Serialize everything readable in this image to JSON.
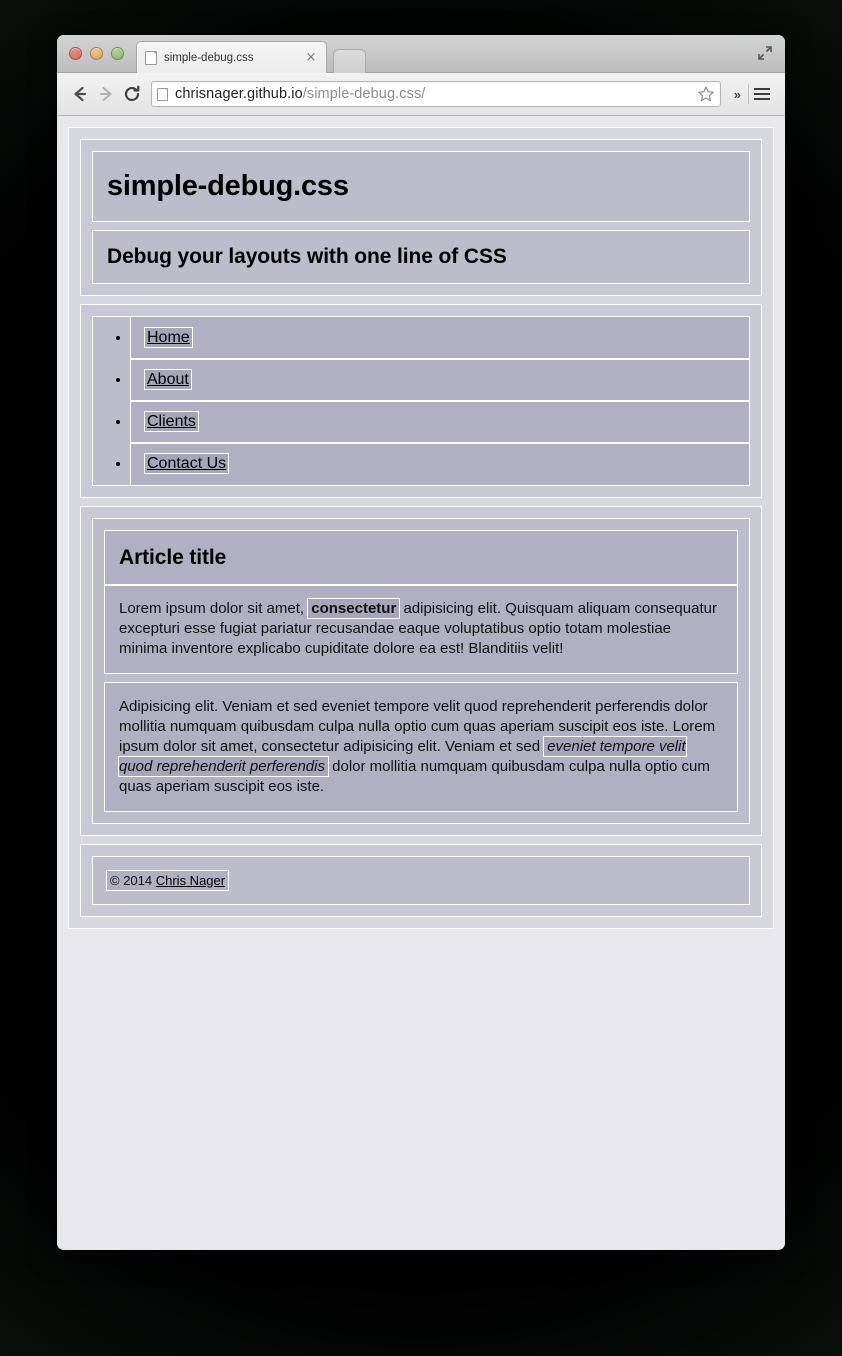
{
  "browser": {
    "tab": {
      "title": "simple-debug.css",
      "close_label": "×",
      "favicon": "page-icon"
    },
    "new_tab_label": "",
    "window_controls": [
      "close",
      "minimize",
      "maximize"
    ],
    "expand_icon": "fullscreen-icon",
    "toolbar": {
      "back_icon": "←",
      "forward_icon": "→",
      "reload_icon": "⟳",
      "url_domain": "chrisnager.github.io",
      "url_path": "/simple-debug.css/",
      "url_full": "chrisnager.github.io/simple-debug.css/",
      "bookmark_icon": "star-icon",
      "overflow_label": "»",
      "menu_icon": "hamburger-icon"
    }
  },
  "page": {
    "header": {
      "title": "simple-debug.css",
      "tagline": "Debug your layouts with one line of CSS"
    },
    "nav": {
      "items": [
        {
          "label": "Home"
        },
        {
          "label": "About"
        },
        {
          "label": "Clients"
        },
        {
          "label": "Contact Us"
        }
      ]
    },
    "article": {
      "title": "Article title",
      "p1": {
        "before": "Lorem ipsum dolor sit amet, ",
        "highlight": "consectetur",
        "after": " adipisicing elit. Quisquam aliquam consequatur excepturi esse fugiat pariatur recusandae eaque voluptatibus optio totam molestiae minima inventore explicabo cupiditate dolore ea est! Blanditiis velit!"
      },
      "p2": {
        "before": "Adipisicing elit. Veniam et sed eveniet tempore velit quod reprehenderit perferendis dolor mollitia numquam quibusdam culpa nulla optio cum quas aperiam suscipit eos iste. Lorem ipsum dolor sit amet, consectetur adipisicing elit. Veniam et sed ",
        "highlight": "eveniet tempore velit quod reprehenderit perferendis",
        "after": " dolor mollitia numquam quibusdam culpa nulla optio cum quas aperiam suscipit eos iste."
      }
    },
    "footer": {
      "copyright_prefix": "© 2014 ",
      "author": "Chris Nager"
    }
  },
  "colors": {
    "debug_outline": "#ffffff",
    "debug_overlay": "rgba(80,80,120,0.10)",
    "page_background": "#e7e7ec",
    "backdrop": "#000000"
  }
}
